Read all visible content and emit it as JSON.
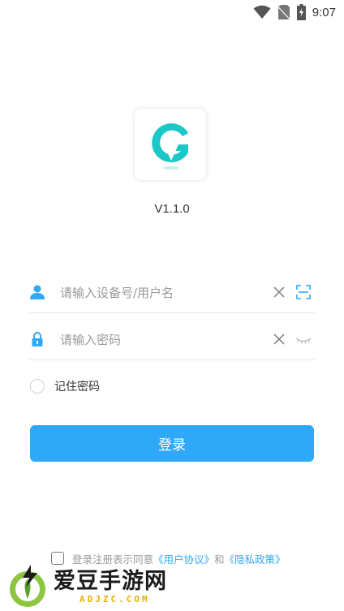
{
  "status_bar": {
    "time": "9:07"
  },
  "app": {
    "version": "V1.1.0"
  },
  "username_field": {
    "placeholder": "请输入设备号/用户名",
    "value": ""
  },
  "password_field": {
    "placeholder": "请输入密码",
    "value": ""
  },
  "remember": {
    "label": "记住密码",
    "checked": false
  },
  "login_button": {
    "label": "登录"
  },
  "agreement": {
    "prefix": "登录注册表示同意",
    "user_agreement": "《用户协议》",
    "and": "和",
    "privacy_policy": "《隐私政策》"
  },
  "watermark": {
    "title": "爱豆手游网",
    "subtitle": "ADJZC.COM"
  },
  "icons": {
    "wifi": "wifi-icon",
    "no-sim": "no-sim-icon",
    "battery": "battery-charging-icon",
    "user": "user-icon",
    "lock": "lock-icon",
    "clear": "clear-icon",
    "scan": "scan-icon",
    "eye-closed": "eye-closed-icon"
  },
  "colors": {
    "accent": "#2fa8f8",
    "logo": "#1cc7c7",
    "watermark_accent": "#e8b000"
  }
}
